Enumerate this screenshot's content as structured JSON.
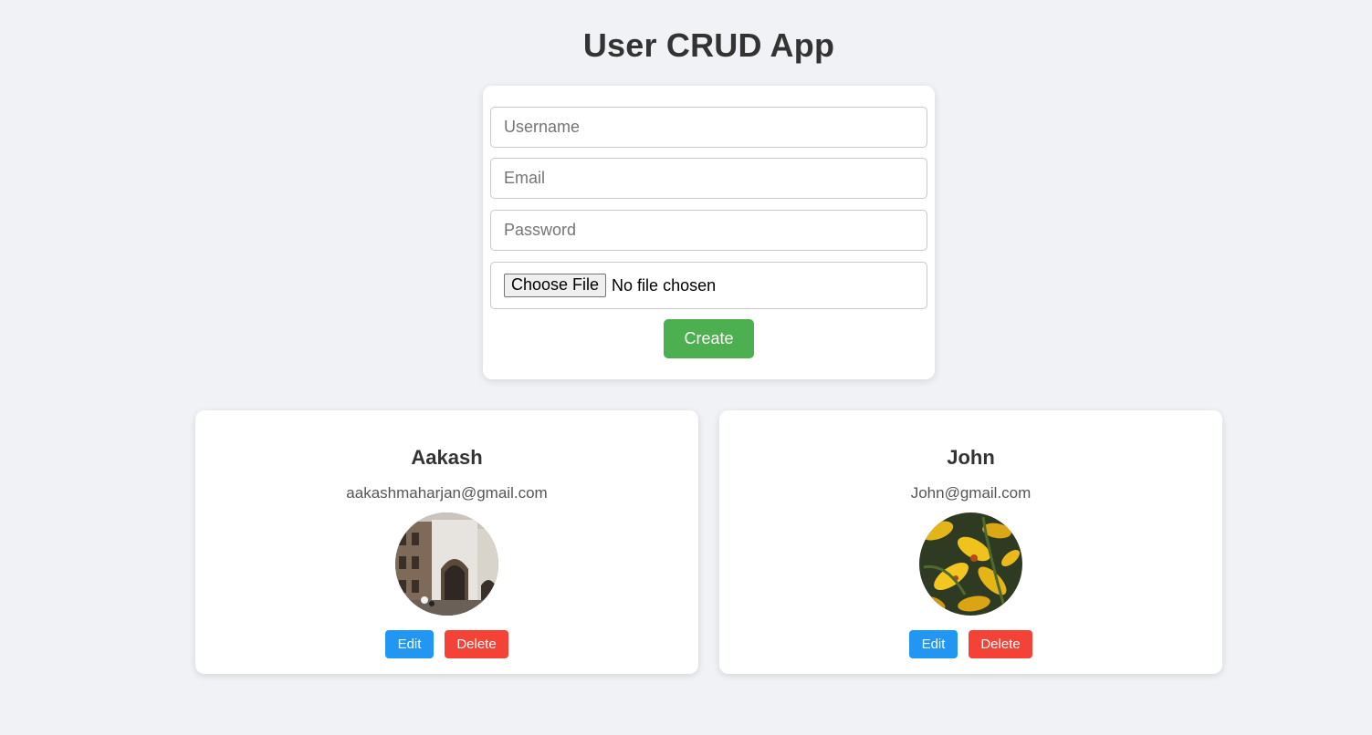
{
  "app": {
    "title": "User CRUD App"
  },
  "form": {
    "username_placeholder": "Username",
    "email_placeholder": "Email",
    "password_placeholder": "Password",
    "file_button_label": "Choose File",
    "file_status": "No file chosen",
    "create_label": "Create"
  },
  "users": [
    {
      "name": "Aakash",
      "email": "aakashmaharjan@gmail.com",
      "avatar_icon": "building-photo",
      "edit_label": "Edit",
      "delete_label": "Delete"
    },
    {
      "name": "John",
      "email": "John@gmail.com",
      "avatar_icon": "yellow-lily-photo",
      "edit_label": "Edit",
      "delete_label": "Delete"
    }
  ],
  "colors": {
    "background": "#f0f2f5",
    "create": "#4caf50",
    "edit": "#2196f3",
    "delete": "#f44336"
  }
}
